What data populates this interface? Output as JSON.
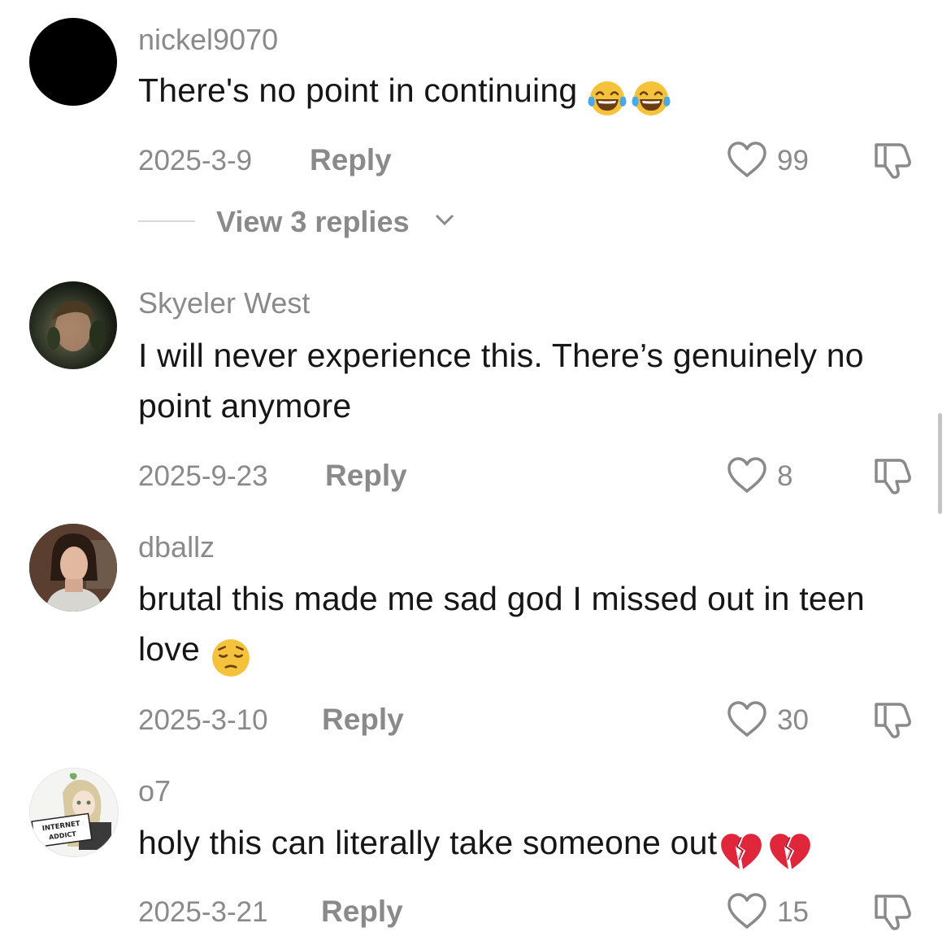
{
  "comments": [
    {
      "username": "nickel9070",
      "text": "There's no point in continuing",
      "emojis": [
        "face-with-tears-of-joy",
        "face-with-tears-of-joy"
      ],
      "date": "2025-3-9",
      "reply_label": "Reply",
      "likes": "99",
      "view_replies": "View 3 replies"
    },
    {
      "username": "Skyeler West",
      "text": "I will never experience this. There’s genuinely no point anymore",
      "date": "2025-9-23",
      "reply_label": "Reply",
      "likes": "8"
    },
    {
      "username": "dballz",
      "text": "brutal this made me sad god I missed out in teen love",
      "emojis": [
        "pensive-face"
      ],
      "date": "2025-3-10",
      "reply_label": "Reply",
      "likes": "30"
    },
    {
      "username": "o7",
      "text": "holy this can literally take someone out",
      "emojis": [
        "broken-heart",
        "broken-heart"
      ],
      "avatar_sign_text": "INTERNET ADDICT",
      "date": "2025-3-21",
      "reply_label": "Reply",
      "likes": "15"
    }
  ],
  "icons": {
    "like": "heart-outline-icon",
    "dislike": "thumbs-down-outline-icon",
    "expand": "chevron-down-icon"
  },
  "colors": {
    "text_primary": "#161616",
    "text_secondary": "#8a8a8a",
    "background": "#ffffff"
  }
}
